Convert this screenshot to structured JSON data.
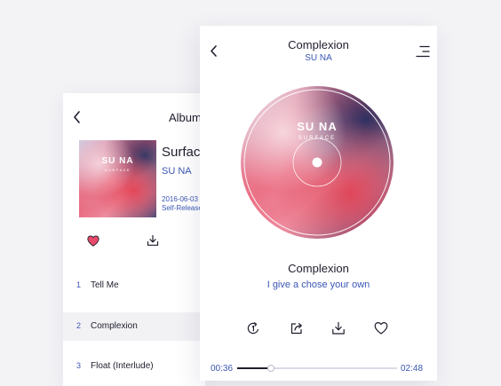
{
  "album_view": {
    "header": "Album",
    "cover": {
      "artist": "SU NA",
      "title": "SURFACE"
    },
    "title": "Surface",
    "artist": "SU NA",
    "date": "2016-06-03",
    "label": "Self-Released",
    "icons": {
      "favorite": "heart-filled-icon",
      "download": "download-icon"
    },
    "tracks": [
      {
        "number": "1",
        "name": "Tell Me"
      },
      {
        "number": "2",
        "name": "Complexion"
      },
      {
        "number": "3",
        "name": "Float (Interlude)"
      }
    ]
  },
  "player": {
    "song_header": "Complexion",
    "artist_header": "SU NA",
    "disc": {
      "artist": "SU NA",
      "title": "SURFACE"
    },
    "song_title": "Complexion",
    "lyric": "I give a chose your own",
    "controls": [
      "repeat-one-icon",
      "share-icon",
      "download-icon",
      "heart-outline-icon"
    ],
    "time_elapsed": "00:36",
    "time_total": "02:48",
    "progress_fraction": 0.21
  },
  "colors": {
    "accent_blue": "#3b57b5",
    "heart_pink": "#e74a6a",
    "text_dark": "#1d1e2c"
  }
}
